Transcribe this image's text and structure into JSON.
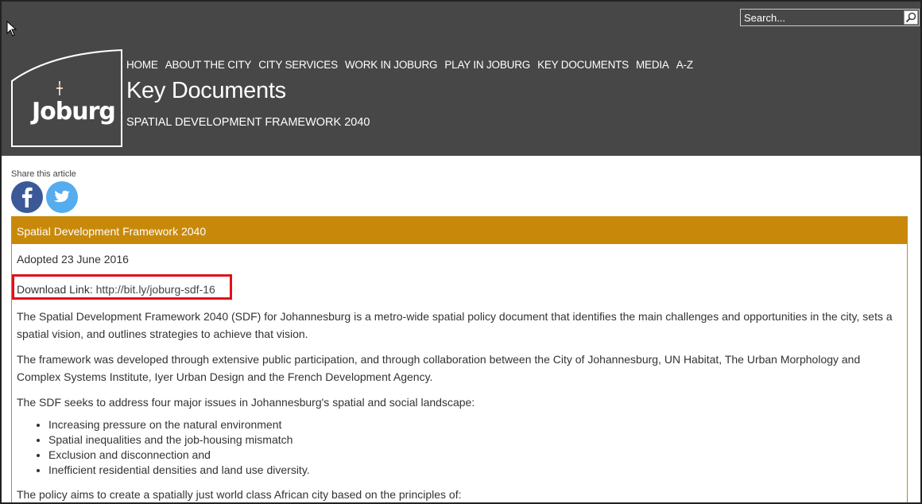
{
  "search": {
    "placeholder": "Search..."
  },
  "nav": {
    "items": [
      "HOME",
      "ABOUT THE CITY",
      "CITY SERVICES",
      "WORK IN JOBURG",
      "PLAY IN JOBURG",
      "KEY DOCUMENTS",
      "MEDIA",
      "A-Z"
    ]
  },
  "logo": {
    "text": "Joburg"
  },
  "page": {
    "title": "Key Documents",
    "subtitle": "SPATIAL DEVELOPMENT FRAMEWORK 2040"
  },
  "share": {
    "label": "Share this article"
  },
  "article": {
    "heading": "Spatial Development Framework 2040",
    "adopted": "Adopted 23 June 2016",
    "download_label": "Download Link: ",
    "download_url": "http://bit.ly/joburg-sdf-16",
    "para1": "The Spatial Development Framework 2040 (SDF) for Johannesburg is a metro-wide spatial policy document that identifies the main challenges and opportunities in the city, sets a spatial vision, and outlines strategies to achieve that vision.",
    "para2": "The framework was developed through extensive public participation, and through collaboration between the City of Johannesburg, UN Habitat, The Urban Morphology and Complex Systems Institute, Iyer Urban Design and the French Development Agency.",
    "para3": "The SDF seeks to address four major issues in Johannesburg's spatial and social landscape:",
    "issues": [
      "Increasing pressure on the natural environment",
      "Spatial inequalities and the job-housing mismatch",
      "Exclusion and disconnection and",
      "Inefficient residential densities and land use diversity."
    ],
    "para4": "The policy aims to create a spatially just world class African city based on the principles of:"
  },
  "colors": {
    "header_bg": "#474747",
    "panel_accent": "#c8890b",
    "facebook": "#3b5998",
    "twitter": "#55acee",
    "highlight": "#e0101a"
  }
}
